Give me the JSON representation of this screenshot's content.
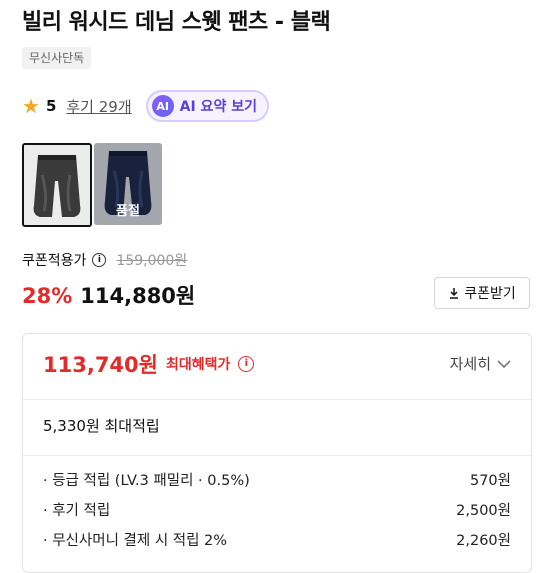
{
  "product": {
    "title": "빌리 워시드 데님 스웻 팬츠 - 블랙",
    "badge": "무신사단독",
    "rating": "5",
    "review_link": "후기 29개",
    "ai_button": {
      "icon": "AI",
      "label": "AI 요약 보기"
    }
  },
  "thumbnails": [
    {
      "name": "black-jeans",
      "selected": true,
      "soldout": false
    },
    {
      "name": "blue-jeans",
      "selected": false,
      "soldout": true,
      "soldout_label": "품절"
    }
  ],
  "pricing": {
    "coupon_label": "쿠폰적용가",
    "original_price": "159,000원",
    "discount": "28%",
    "price": "114,880원",
    "coupon_button": "쿠폰받기"
  },
  "benefit_panel": {
    "max_price": "113,740원",
    "max_price_label": "최대혜택가",
    "detail_button": "자세히",
    "max_points": "5,330원 최대적립",
    "breakdown": [
      {
        "label": "· 등급 적립 (LV.3 패밀리 · 0.5%)",
        "value": "570원"
      },
      {
        "label": "· 후기 적립",
        "value": "2,500원"
      },
      {
        "label": "· 무신사머니 결제 시 적립 2%",
        "value": "2,260원"
      }
    ]
  },
  "colors": {
    "accent_red": "#e32b2b",
    "ai_purple": "#5b3fd6",
    "star": "#f5a623"
  },
  "icons": [
    "star-icon",
    "info-icon",
    "download-icon",
    "chevron-down-icon"
  ]
}
